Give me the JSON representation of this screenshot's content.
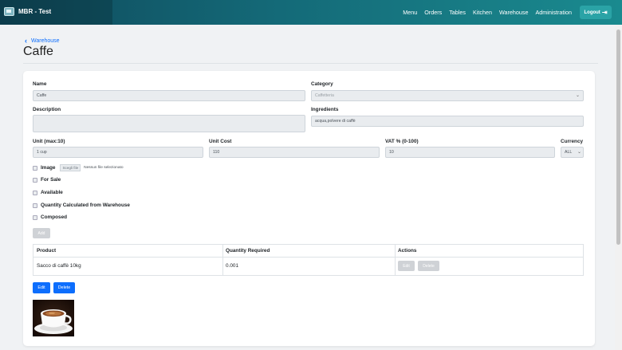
{
  "app": {
    "title": "MBR - Test"
  },
  "nav": {
    "links": [
      "Menu",
      "Orders",
      "Tables",
      "Kitchen",
      "Warehouse",
      "Administration"
    ],
    "logout_label": "Logout"
  },
  "breadcrumb": {
    "back_label": "Warehouse"
  },
  "page": {
    "title": "Caffe"
  },
  "form": {
    "name_label": "Name",
    "name_value": "Caffe",
    "category_label": "Category",
    "category_value": "Caffetteria",
    "description_label": "Description",
    "description_value": "",
    "ingredients_label": "Ingredients",
    "ingredients_value": "acqua,polvere di caffè",
    "unit_label": "Unit (max:10)",
    "unit_value": "1 cup",
    "unit_cost_label": "Unit Cost",
    "unit_cost_value": "110",
    "vat_label": "VAT % (0-100)",
    "vat_value": "10",
    "currency_label": "Currency",
    "currency_value": "ALL",
    "image_label": "Image",
    "file_button_label": "Scegli file",
    "file_status": "Nessun file selezionato",
    "for_sale_label": "For Sale",
    "available_label": "Available",
    "qty_from_warehouse_label": "Quantity Calculated from Warehouse",
    "composed_label": "Composed",
    "add_button_label": "Add"
  },
  "table": {
    "headers": [
      "Product",
      "Quantity Required",
      "Actions"
    ],
    "rows": [
      {
        "product": "Sacco di caffè 10kg",
        "quantity": "0.001",
        "edit_label": "Edit",
        "delete_label": "Delete"
      }
    ]
  },
  "actions": {
    "edit_label": "Edit",
    "delete_label": "Delete"
  },
  "colors": {
    "primary": "#0d6efd",
    "nav_start": "#0f4a5c",
    "nav_end": "#1a8a8f",
    "logout": "#2aa3a6"
  }
}
